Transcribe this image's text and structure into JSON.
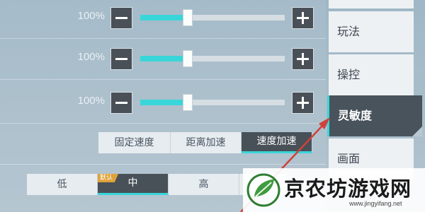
{
  "sliders": [
    {
      "percent_label": "100%",
      "value": 0.33
    },
    {
      "percent_label": "100%",
      "value": 0.33
    },
    {
      "percent_label": "100%",
      "value": 0.33
    }
  ],
  "acceleration_options": [
    "固定速度",
    "距离加速",
    "速度加速"
  ],
  "acceleration_selected": "速度加速",
  "quality_options": [
    "低",
    "中",
    "高",
    ""
  ],
  "quality_selected": "中",
  "quality_default_badge": "默认",
  "sidebar": {
    "tabs": [
      "",
      "玩法",
      "操控",
      "灵敏度",
      "画面"
    ],
    "active": "灵敏度"
  },
  "watermark": {
    "title": "京农坊游戏网",
    "url": "www.jingyifang.net"
  },
  "colors": {
    "accent": "#39d6d9",
    "selected_bg": "#485058",
    "badge": "#e0a23a",
    "arrow": "#d0413a"
  }
}
